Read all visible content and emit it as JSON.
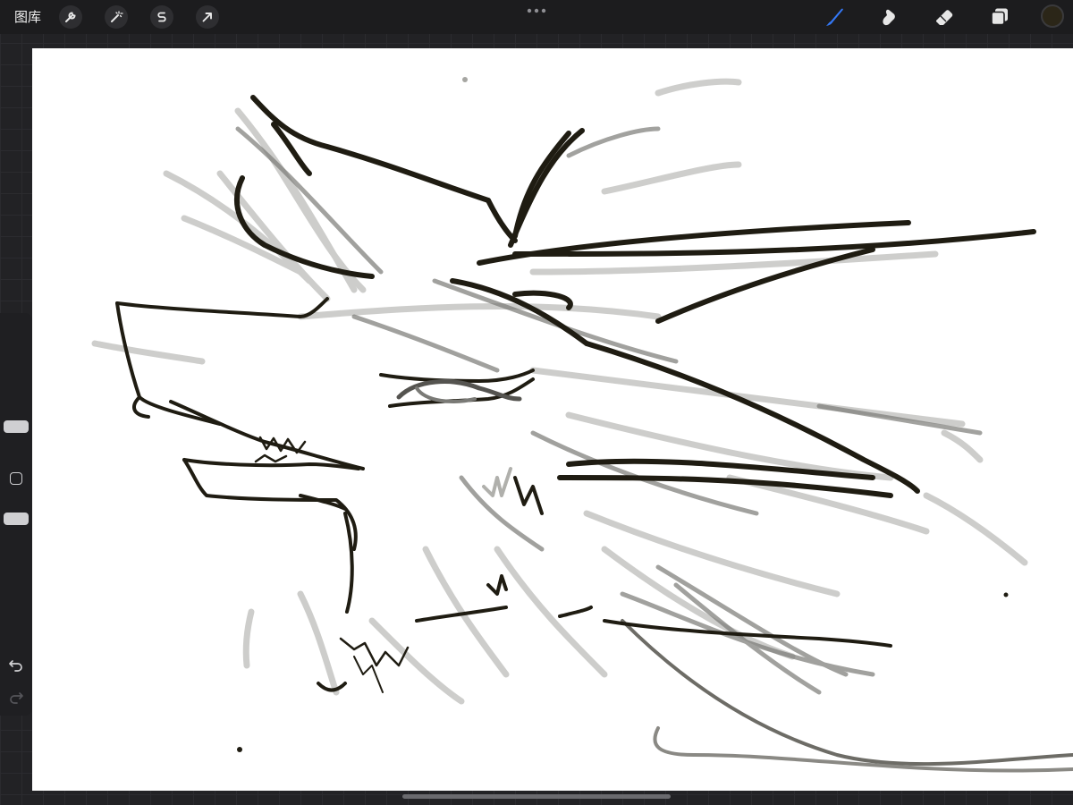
{
  "toolbar": {
    "gallery_label": "图库",
    "left_tools": [
      "wrench-icon",
      "magic-wand-icon",
      "selection-s-icon",
      "move-arrow-icon"
    ],
    "more_icon": "ellipsis-icon",
    "right_tools": [
      "brush-icon",
      "smudge-icon",
      "eraser-icon",
      "layers-icon"
    ],
    "active_tool": "brush-icon",
    "active_tool_color": "#3478f6",
    "current_color": "#2b2618"
  },
  "sidebar": {
    "brush_size_icon": "brush-size-slider",
    "modify_icon": "square-icon",
    "opacity_icon": "opacity-slider",
    "undo_icon": "undo-icon",
    "redo_icon": "redo-icon"
  },
  "canvas": {
    "background": "#ffffff",
    "ink_color": "#1f1c12"
  }
}
